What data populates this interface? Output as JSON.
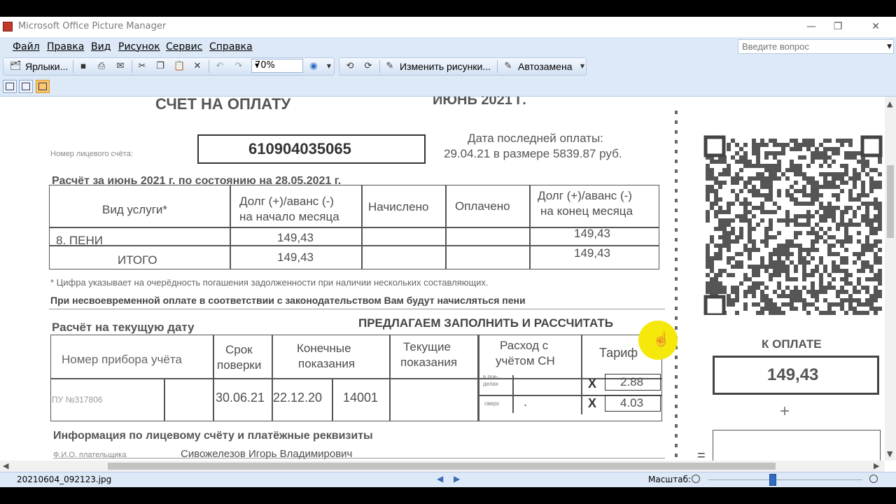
{
  "window": {
    "title": "Microsoft Office Picture Manager",
    "controls": {
      "minimize": "—",
      "restore": "❐",
      "close": "✕"
    }
  },
  "menu": {
    "items": [
      "Файл",
      "Правка",
      "Вид",
      "Рисунок",
      "Сервис",
      "Справка"
    ],
    "help_placeholder": "Введите вопрос"
  },
  "toolbar": {
    "shortcuts_label": "Ярлыки...",
    "zoom_value": "70%",
    "edit_pictures_label": "Изменить рисунки...",
    "autocorrect_label": "Автозамена"
  },
  "document": {
    "header_title": "СЧЕТ НА ОПЛАТУ",
    "header_month": "ИЮНЬ 2021 Г.",
    "account_label": "Номер лицевого счёта:",
    "account_number": "610904035065",
    "last_payment_line1": "Дата последней оплаты:",
    "last_payment_line2": "29.04.21 в размере 5839.87 руб.",
    "calc_title": "Расчёт за июнь 2021 г. по состоянию на 28.05.2021 г.",
    "table1": {
      "headers": [
        "Вид услуги*",
        "Долг (+)/аванс (-)",
        "на начало месяца",
        "Начислено",
        "Оплачено",
        "Долг (+)/аванс (-)",
        "на конец месяца"
      ],
      "rows": [
        {
          "service": "8. ПЕНИ",
          "start": "149,43",
          "accrued": "",
          "paid": "",
          "end": "149,43"
        },
        {
          "service": "ИТОГО",
          "start": "149,43",
          "accrued": "",
          "paid": "",
          "end": "149,43"
        }
      ]
    },
    "footnote": "* Цифра указывает на очерёдность погашения задолженности при наличии нескольких составляющих.",
    "penalty_note": "При несвоевременной оплате в соответствии с законодательством Вам будут начисляться пени",
    "current_calc_title": "Расчёт на текущую дату",
    "fill_in_title": "ПРЕДЛАГАЕМ ЗАПОЛНИТЬ И РАССЧИТАТЬ",
    "table2": {
      "h_meter": "Номер прибора учёта",
      "h_check1": "Срок",
      "h_check2": "поверки",
      "h_final1": "Конечные",
      "h_final2": "показания",
      "h_current1": "Текущие",
      "h_current2": "показания",
      "h_usage1": "Расход с",
      "h_usage2": "учётом СН",
      "h_tariff": "Тариф",
      "meter": "ПУ №317806",
      "check_date": "30.06.21",
      "final_date": "22.12.20",
      "final_value": "14001",
      "sub1a": "в пре-",
      "sub1b": "делах",
      "sub2": "сверх",
      "mult": "X",
      "tariff1": "2.88",
      "tariff2": "4.03",
      "dot": "."
    },
    "info_title": "Информация по лицевому счёту и платёжные реквизиты",
    "payer_label": "Ф.И.О. плательщика",
    "payer_name": "Сивожелезов Игорь Владимирович",
    "to_pay_label": "К ОПЛАТЕ",
    "to_pay_amount": "149,43",
    "plus": "+",
    "equals": "="
  },
  "status": {
    "filename": "20210604_092123.jpg",
    "zoom_label": "Масштаб:",
    "prev": "◀",
    "next": "▶"
  },
  "colors": {
    "bar_bg": "#dde9f7",
    "highlight": "#f5e90b",
    "active_view": "#fbc66e"
  }
}
